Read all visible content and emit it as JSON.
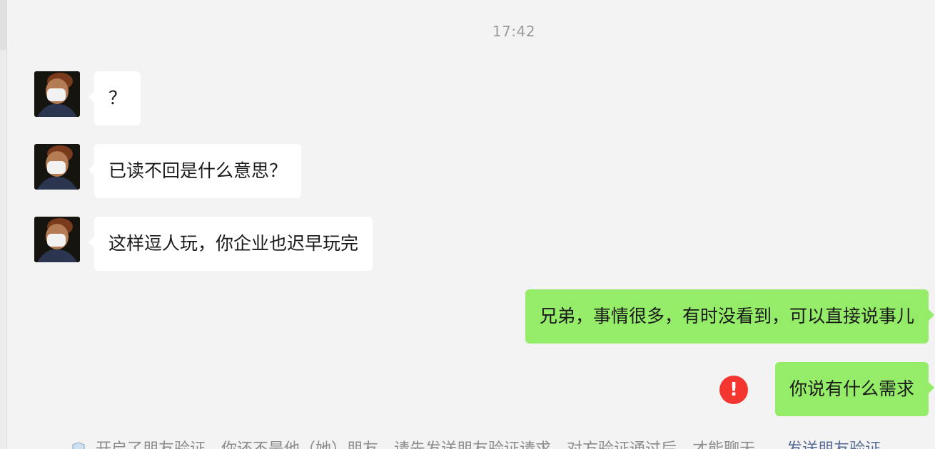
{
  "timestamp": "17:42",
  "messages": [
    {
      "direction": "incoming",
      "text": "？",
      "avatar": "masked-person-avatar"
    },
    {
      "direction": "incoming",
      "text": "已读不回是什么意思？",
      "avatar": "masked-person-avatar"
    },
    {
      "direction": "incoming",
      "text": "这样逗人玩，你企业也迟早玩完",
      "avatar": "masked-person-avatar"
    },
    {
      "direction": "outgoing",
      "text": "兄弟，事情很多，有时没看到，可以直接说事儿"
    },
    {
      "direction": "outgoing",
      "text": "你说有什么需求",
      "status": "failed"
    }
  ],
  "error_icon": {
    "glyph": "!",
    "color": "#f43530"
  },
  "notice": {
    "text": "开启了朋友验证，你还不是他（她）朋友。请先发送朋友验证请求，对方验证通过后，才能聊天。",
    "link": "发送朋友验证"
  },
  "colors": {
    "background": "#f3f3f3",
    "incoming_bubble": "#ffffff",
    "outgoing_bubble": "#95ec69",
    "timestamp_text": "#9b9b9b",
    "link": "#576b95"
  }
}
